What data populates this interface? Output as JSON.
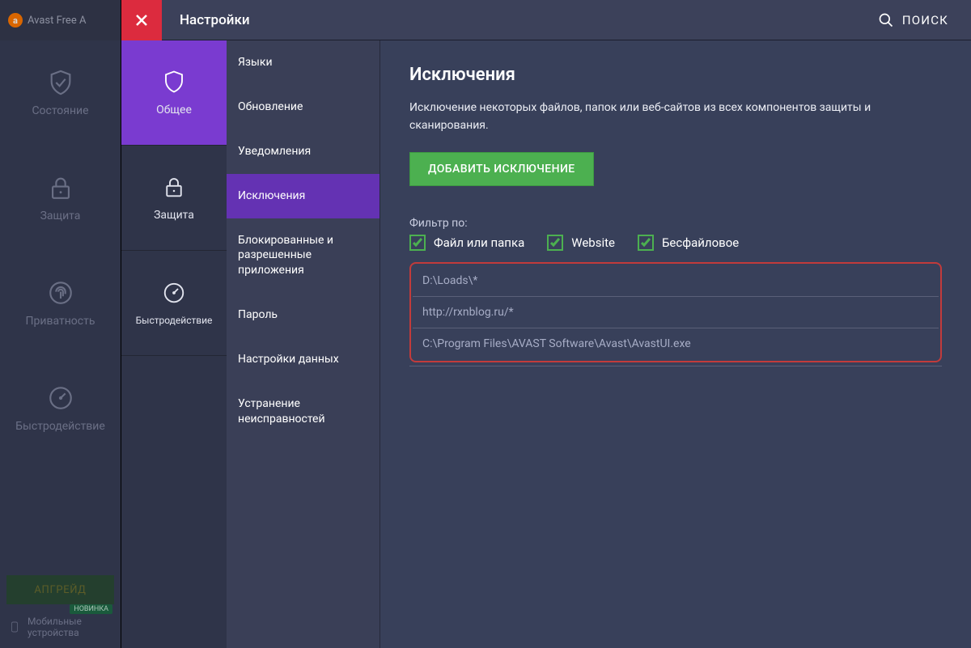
{
  "app_title": "Avast Free A",
  "main_sidebar": {
    "items": [
      {
        "label": "Состояние"
      },
      {
        "label": "Защита"
      },
      {
        "label": "Приватность"
      },
      {
        "label": "Быстродействие"
      }
    ],
    "upgrade_label": "АПГРЕЙД",
    "mobile": {
      "line1": "Мобильные",
      "line2": "устройства",
      "badge": "НОВИНКА"
    }
  },
  "modal": {
    "title": "Настройки",
    "search_label": "ПОИСК",
    "categories": [
      {
        "label": "Общее"
      },
      {
        "label": "Защита"
      },
      {
        "label": "Быстродействие"
      }
    ],
    "active_category_index": 0,
    "subsections": [
      "Языки",
      "Обновление",
      "Уведомления",
      "Исключения",
      "Блокированные и разрешенные приложения",
      "Пароль",
      "Настройки данных",
      "Устранение неисправностей"
    ],
    "active_subsection_index": 3
  },
  "content": {
    "title": "Исключения",
    "description": "Исключение некоторых файлов, папок или веб-сайтов из всех компонентов защиты и сканирования.",
    "add_button": "ДОБАВИТЬ ИСКЛЮЧЕНИЕ",
    "filter_label": "Фильтр по:",
    "filters": [
      {
        "label": "Файл или папка",
        "checked": true
      },
      {
        "label": "Website",
        "checked": true
      },
      {
        "label": "Бесфайловое",
        "checked": true
      }
    ],
    "exclusions": [
      "D:\\Loads\\*",
      "http://rxnblog.ru/*",
      "C:\\Program Files\\AVAST Software\\Avast\\AvastUI.exe"
    ]
  }
}
